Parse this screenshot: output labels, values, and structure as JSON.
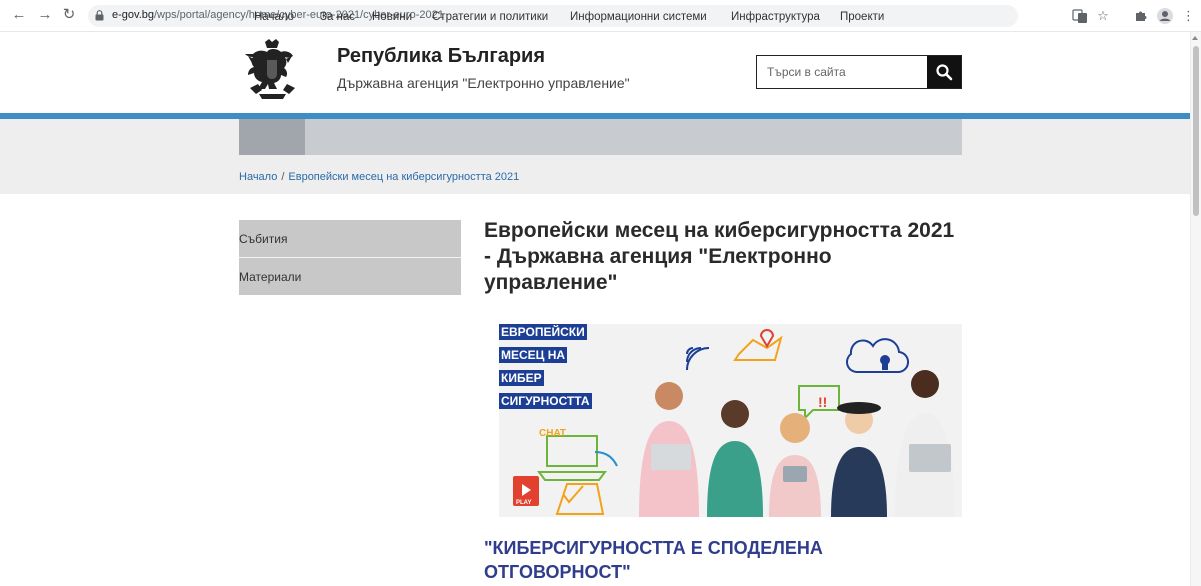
{
  "browser": {
    "url_host": "e-gov.bg",
    "url_path": "/wps/portal/agency/home/cyber-euro-2021/cyber-euro-2021"
  },
  "header": {
    "title": "Република България",
    "subtitle": "Държавна агенция \"Електронно управление\"",
    "search_placeholder": "Търси в сайта"
  },
  "nav": {
    "items": [
      "Начало",
      "За нас",
      "Новини",
      "Стратегии и политики",
      "Информационни системи",
      "Инфраструктура",
      "Проекти"
    ]
  },
  "breadcrumb": {
    "home": "Начало",
    "separator": "/",
    "current": "Европейски месец на киберсигурността 2021"
  },
  "sidebar": {
    "items": [
      "Събития",
      "Материали"
    ]
  },
  "main": {
    "title": "Европейски месец на киберсигурността 2021 - Държавна агенция \"Електронно управление\"",
    "banner_lines": [
      "ЕВРОПЕЙСКИ",
      "МЕСЕЦ НА",
      "КИБЕР",
      "СИГУРНОСТТА"
    ],
    "banner_chat": "CHAT",
    "banner_play": "PLAY",
    "subtitle": "\"КИБЕРСИГУРНОСТТА Е СПОДЕЛЕНА ОТГОВОРНОСТ\""
  },
  "colors": {
    "accent_blue": "#3c8ec4",
    "nav_bg": "#c8ccd0",
    "subtitle_color": "#2f3d8c",
    "banner_label": "#1c3f95"
  }
}
